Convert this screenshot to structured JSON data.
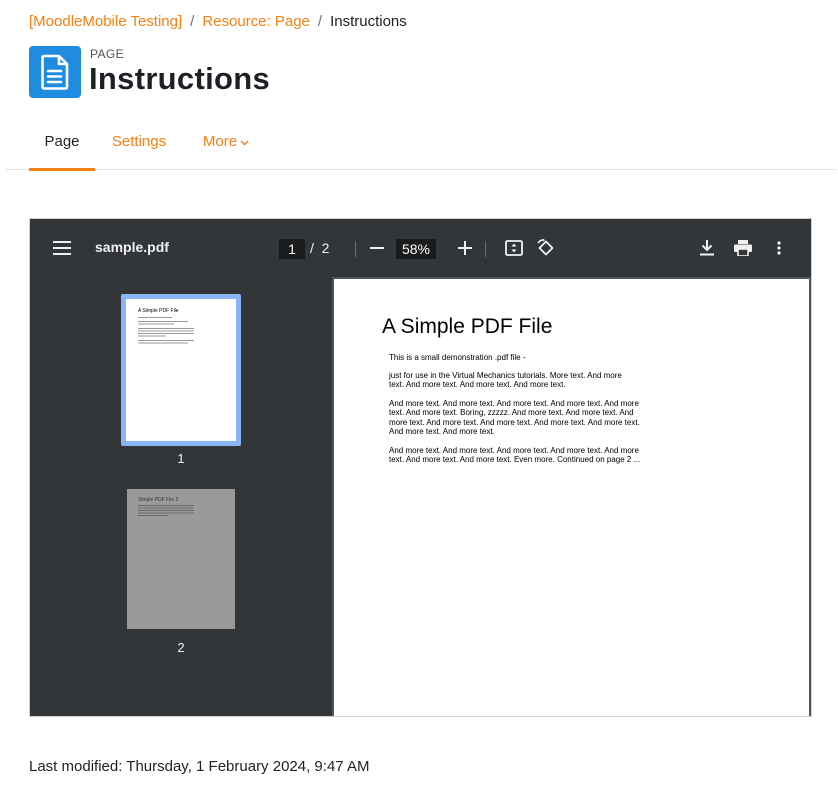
{
  "breadcrumb": {
    "items": [
      "[MoodleMobile Testing]",
      "Resource: Page"
    ],
    "separator": "/",
    "current": "Instructions"
  },
  "header": {
    "pre_title": "PAGE",
    "title": "Instructions",
    "icon": "page-document-icon"
  },
  "tabs": [
    {
      "label": "Page",
      "active": true
    },
    {
      "label": "Settings",
      "active": false
    },
    {
      "label": "More",
      "active": false
    }
  ],
  "pdf_viewer": {
    "filename": "sample.pdf",
    "current_page": "1",
    "page_separator": "/",
    "total_pages": "2",
    "zoom": "58%",
    "thumbnails": [
      {
        "number": "1",
        "title": "A Simple PDF File",
        "selected": true
      },
      {
        "number": "2",
        "title": "Simple PDF File 2",
        "selected": false
      }
    ],
    "document": {
      "title": "A Simple PDF File",
      "paragraphs": [
        "This is a small demonstration .pdf file -",
        "just for use in the Virtual Mechanics tutorials. More text. And more text. And more text. And more text. And more text.",
        "And more text. And more text. And more text. And more text. And more text. And more text. Boring, zzzzz. And more text. And more text. And more text. And more text. And more text. And more text. And more text. And more text. And more text.",
        "And more text. And more text. And more text. And more text. And more text. And more text. And more text. Even more. Continued on page 2 ..."
      ]
    }
  },
  "footer": {
    "last_modified": "Last modified: Thursday, 1 February 2024, 9:47 AM"
  },
  "colors": {
    "accent": "#f98012",
    "icon_blue": "#1f8ce0",
    "viewer_toolbar": "#323639",
    "thumb_selected_border": "#8ab4f8"
  }
}
